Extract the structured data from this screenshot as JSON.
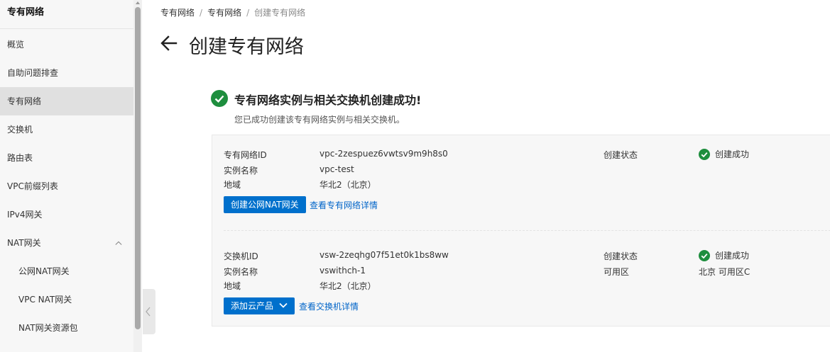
{
  "sidebar": {
    "title": "专有网络",
    "items": [
      {
        "label": "概览"
      },
      {
        "label": "自助问题排查"
      },
      {
        "label": "专有网络",
        "active": true
      },
      {
        "label": "交换机"
      },
      {
        "label": "路由表"
      },
      {
        "label": "VPC前缀列表"
      },
      {
        "label": "IPv4网关"
      },
      {
        "label": "NAT网关",
        "expanded": true
      },
      {
        "label": "公网NAT网关",
        "sub": true
      },
      {
        "label": "VPC NAT网关",
        "sub": true
      },
      {
        "label": "NAT网关资源包",
        "sub": true
      }
    ]
  },
  "breadcrumb": [
    "专有网络",
    "专有网络",
    "创建专有网络"
  ],
  "page": {
    "title": "创建专有网络"
  },
  "result": {
    "title": "专有网络实例与相关交换机创建成功!",
    "subtitle": "您已成功创建该专有网络实例与相关交换机。"
  },
  "vpc": {
    "id_label": "专有网络ID",
    "id_value": "vpc-2zespuez6vwtsv9m9h8s0",
    "name_label": "实例名称",
    "name_value": "vpc-test",
    "region_label": "地域",
    "region_value": "华北2（北京）",
    "status_label": "创建状态",
    "status_value": "创建成功",
    "primary_button": "创建公网NAT网关",
    "detail_link": "查看专有网络详情"
  },
  "vswitch": {
    "id_label": "交换机ID",
    "id_value": "vsw-2zeqhg07f51et0k1bs8ww",
    "name_label": "实例名称",
    "name_value": "vswithch-1",
    "region_label": "地域",
    "region_value": "华北2（北京）",
    "status_label": "创建状态",
    "status_value": "创建成功",
    "zone_label": "可用区",
    "zone_value": "北京 可用区C",
    "primary_button": "添加云产品",
    "detail_link": "查看交换机详情"
  },
  "colors": {
    "primary": "#0070cc",
    "link": "#0064c8",
    "success": "#1e8e3e"
  }
}
